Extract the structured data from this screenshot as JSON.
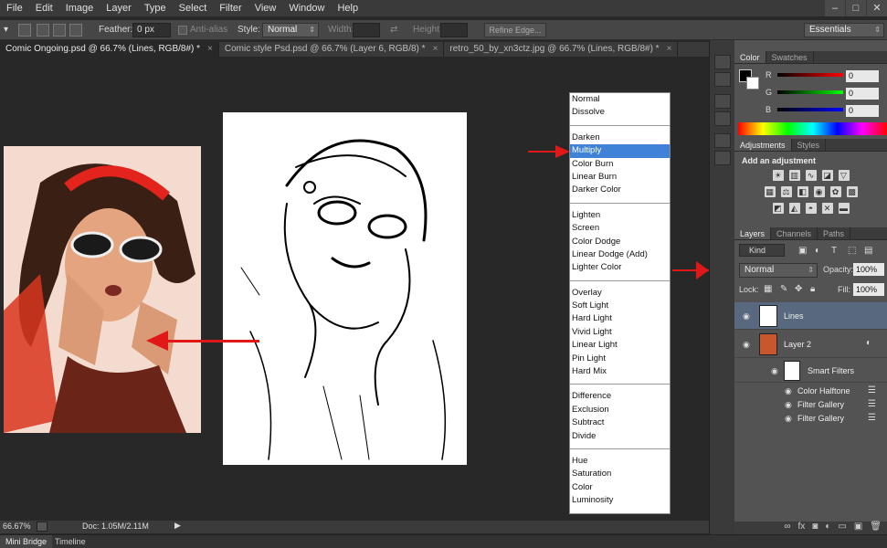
{
  "menu": [
    "File",
    "Edit",
    "Image",
    "Layer",
    "Type",
    "Select",
    "Filter",
    "View",
    "Window",
    "Help"
  ],
  "window_buttons": [
    "–",
    "□",
    "✕"
  ],
  "options_bar": {
    "feather_label": "Feather:",
    "feather_value": "0 px",
    "anti_alias_label": "Anti-alias",
    "style_label": "Style:",
    "style_value": "Normal",
    "width_label": "Width:",
    "height_label": "Height:",
    "refine_edge_label": "Refine Edge...",
    "workspace": "Essentials"
  },
  "tabs": [
    {
      "label": "Comic Ongoing.psd @ 66.7% (Lines, RGB/8#) *",
      "active": true
    },
    {
      "label": "Comic style Psd.psd @ 66.7% (Layer 6, RGB/8) *",
      "active": false
    },
    {
      "label": "retro_50_by_xn3ctz.jpg @ 66.7% (Lines, RGB/8#) *",
      "active": false
    }
  ],
  "blend_modes": {
    "selected": "Multiply",
    "groups": [
      [
        "Normal",
        "Dissolve"
      ],
      [
        "Darken",
        "Multiply",
        "Color Burn",
        "Linear Burn",
        "Darker Color"
      ],
      [
        "Lighten",
        "Screen",
        "Color Dodge",
        "Linear Dodge (Add)",
        "Lighter Color"
      ],
      [
        "Overlay",
        "Soft Light",
        "Hard Light",
        "Vivid Light",
        "Linear Light",
        "Pin Light",
        "Hard Mix"
      ],
      [
        "Difference",
        "Exclusion",
        "Subtract",
        "Divide"
      ],
      [
        "Hue",
        "Saturation",
        "Color",
        "Luminosity"
      ]
    ]
  },
  "status": {
    "zoom": "66.67%",
    "doc": "Doc: 1.05M/2.11M"
  },
  "bottom_tabs": [
    "Mini Bridge",
    "Timeline"
  ],
  "color_panel": {
    "tabs": [
      "Color",
      "Swatches"
    ],
    "channels": [
      {
        "name": "R",
        "value": "0"
      },
      {
        "name": "G",
        "value": "0"
      },
      {
        "name": "B",
        "value": "0"
      }
    ]
  },
  "adjustments_panel": {
    "tabs": [
      "Adjustments",
      "Styles"
    ],
    "heading": "Add an adjustment"
  },
  "layers_panel": {
    "tabs": [
      "Layers",
      "Channels",
      "Paths"
    ],
    "filter_kind": "Kind",
    "blend_mode": "Normal",
    "opacity_label": "Opacity:",
    "opacity_value": "100%",
    "lock_label": "Lock:",
    "fill_label": "Fill:",
    "fill_value": "100%",
    "layers": [
      {
        "name": "Lines",
        "selected": true
      },
      {
        "name": "Layer 2",
        "selected": false
      }
    ],
    "smart_filters_label": "Smart Filters",
    "filters": [
      "Color Halftone",
      "Filter Gallery",
      "Filter Gallery"
    ]
  },
  "colors": {
    "menubar": "#3a3a3a",
    "canvas_bg": "#282828",
    "panel_bg": "#535353",
    "selection_blue": "#3f82d8",
    "arrow_red": "#e01818",
    "selected_layer": "#58697f"
  }
}
